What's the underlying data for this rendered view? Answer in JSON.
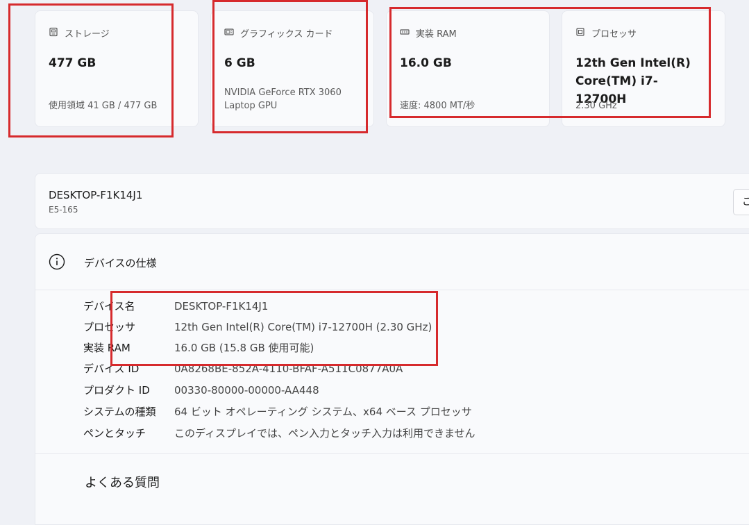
{
  "cards": [
    {
      "icon": "storage-icon",
      "label": "ストレージ",
      "value": "477 GB",
      "sub": "使用領域 41 GB / 477 GB"
    },
    {
      "icon": "graphics-card-icon",
      "label": "グラフィックス カード",
      "value": "6 GB",
      "sub": "NVIDIA GeForce RTX 3060 Laptop GPU"
    },
    {
      "icon": "ram-icon",
      "label": "実装 RAM",
      "value": "16.0 GB",
      "sub": "速度: 4800 MT/秒"
    },
    {
      "icon": "processor-icon",
      "label": "プロセッサ",
      "value": "12th Gen Intel(R) Core(TM) i7-12700H",
      "sub": "2.30 GHz"
    }
  ],
  "device": {
    "name": "DESKTOP-F1K14J1",
    "model": "E5-165",
    "rename_label": "この"
  },
  "specs": {
    "title": "デバイスの仕様",
    "rows": [
      {
        "key": "デバイス名",
        "value": "DESKTOP-F1K14J1"
      },
      {
        "key": "プロセッサ",
        "value": "12th Gen Intel(R) Core(TM) i7-12700H (2.30 GHz)"
      },
      {
        "key": "実装 RAM",
        "value": "16.0 GB (15.8 GB 使用可能)"
      },
      {
        "key": "デバイス ID",
        "value": "0A8268BE-852A-4110-BFAF-A511C0877A0A"
      },
      {
        "key": "プロダクト ID",
        "value": "00330-80000-00000-AA448"
      },
      {
        "key": "システムの種類",
        "value": "64 ビット オペレーティング システム、x64 ベース プロセッサ"
      },
      {
        "key": "ペンとタッチ",
        "value": "このディスプレイでは、ペン入力とタッチ入力は利用できません"
      }
    ]
  },
  "faq": {
    "title": "よくある質問"
  },
  "colors": {
    "highlight": "#d62a2d",
    "background": "#eff1f6"
  }
}
